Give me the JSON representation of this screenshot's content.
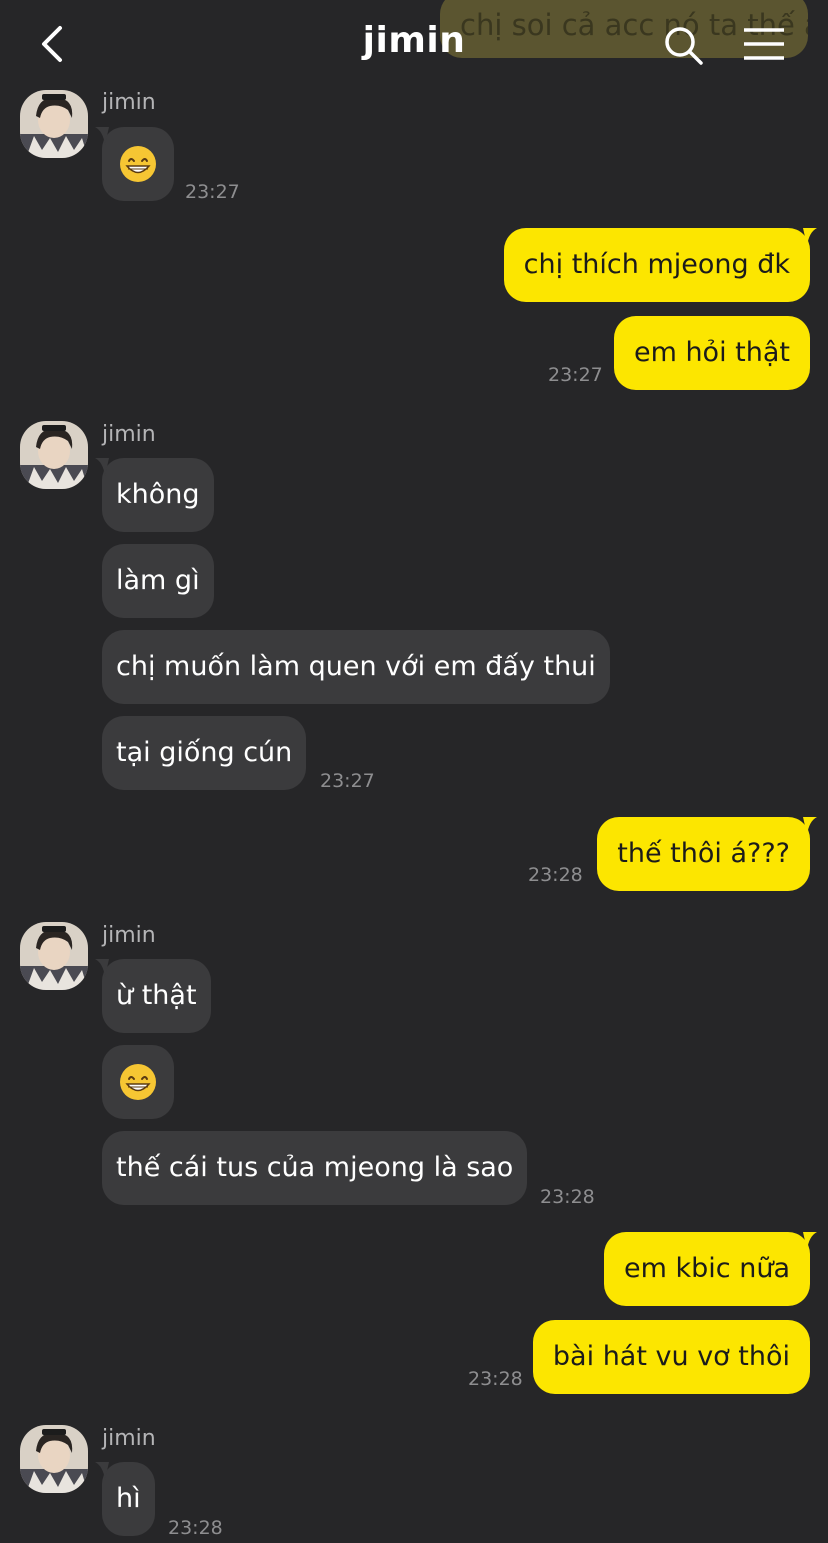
{
  "header": {
    "title": "jimin",
    "ghost_preview": "chị soi cả acc nó ta thế à"
  },
  "messages": {
    "g1_sender": "jimin",
    "g1_time": "23:27",
    "m3": "chị thích mjeong đk",
    "m4": "em hỏi thật",
    "g2_time": "23:27",
    "g3_sender": "jimin",
    "m5": "không",
    "m6": "làm gì",
    "m7": "chị muốn làm quen với em đấy thui",
    "m8": "tại giống cún",
    "g3_time": "23:27",
    "m9": "thế thôi á???",
    "g4_time": "23:28",
    "g5_sender": "jimin",
    "m10": "ừ thật",
    "m12": "thế cái tus của mjeong là sao",
    "g5_time": "23:28",
    "m13": "em kbic nữa",
    "m14": "bài hát vu vơ thôi",
    "g6_time": "23:28",
    "g7_sender": "jimin",
    "m15": "hì",
    "g7_time": "23:28"
  },
  "colors": {
    "background": "#262628",
    "incoming_bubble": "#3b3b3d",
    "outgoing_bubble": "#fce600",
    "timestamp": "#8e8e90"
  },
  "icons": {
    "back": "chevron-left-icon",
    "search": "search-icon",
    "menu": "menu-icon",
    "emoji": "grinning-face-emoji"
  }
}
